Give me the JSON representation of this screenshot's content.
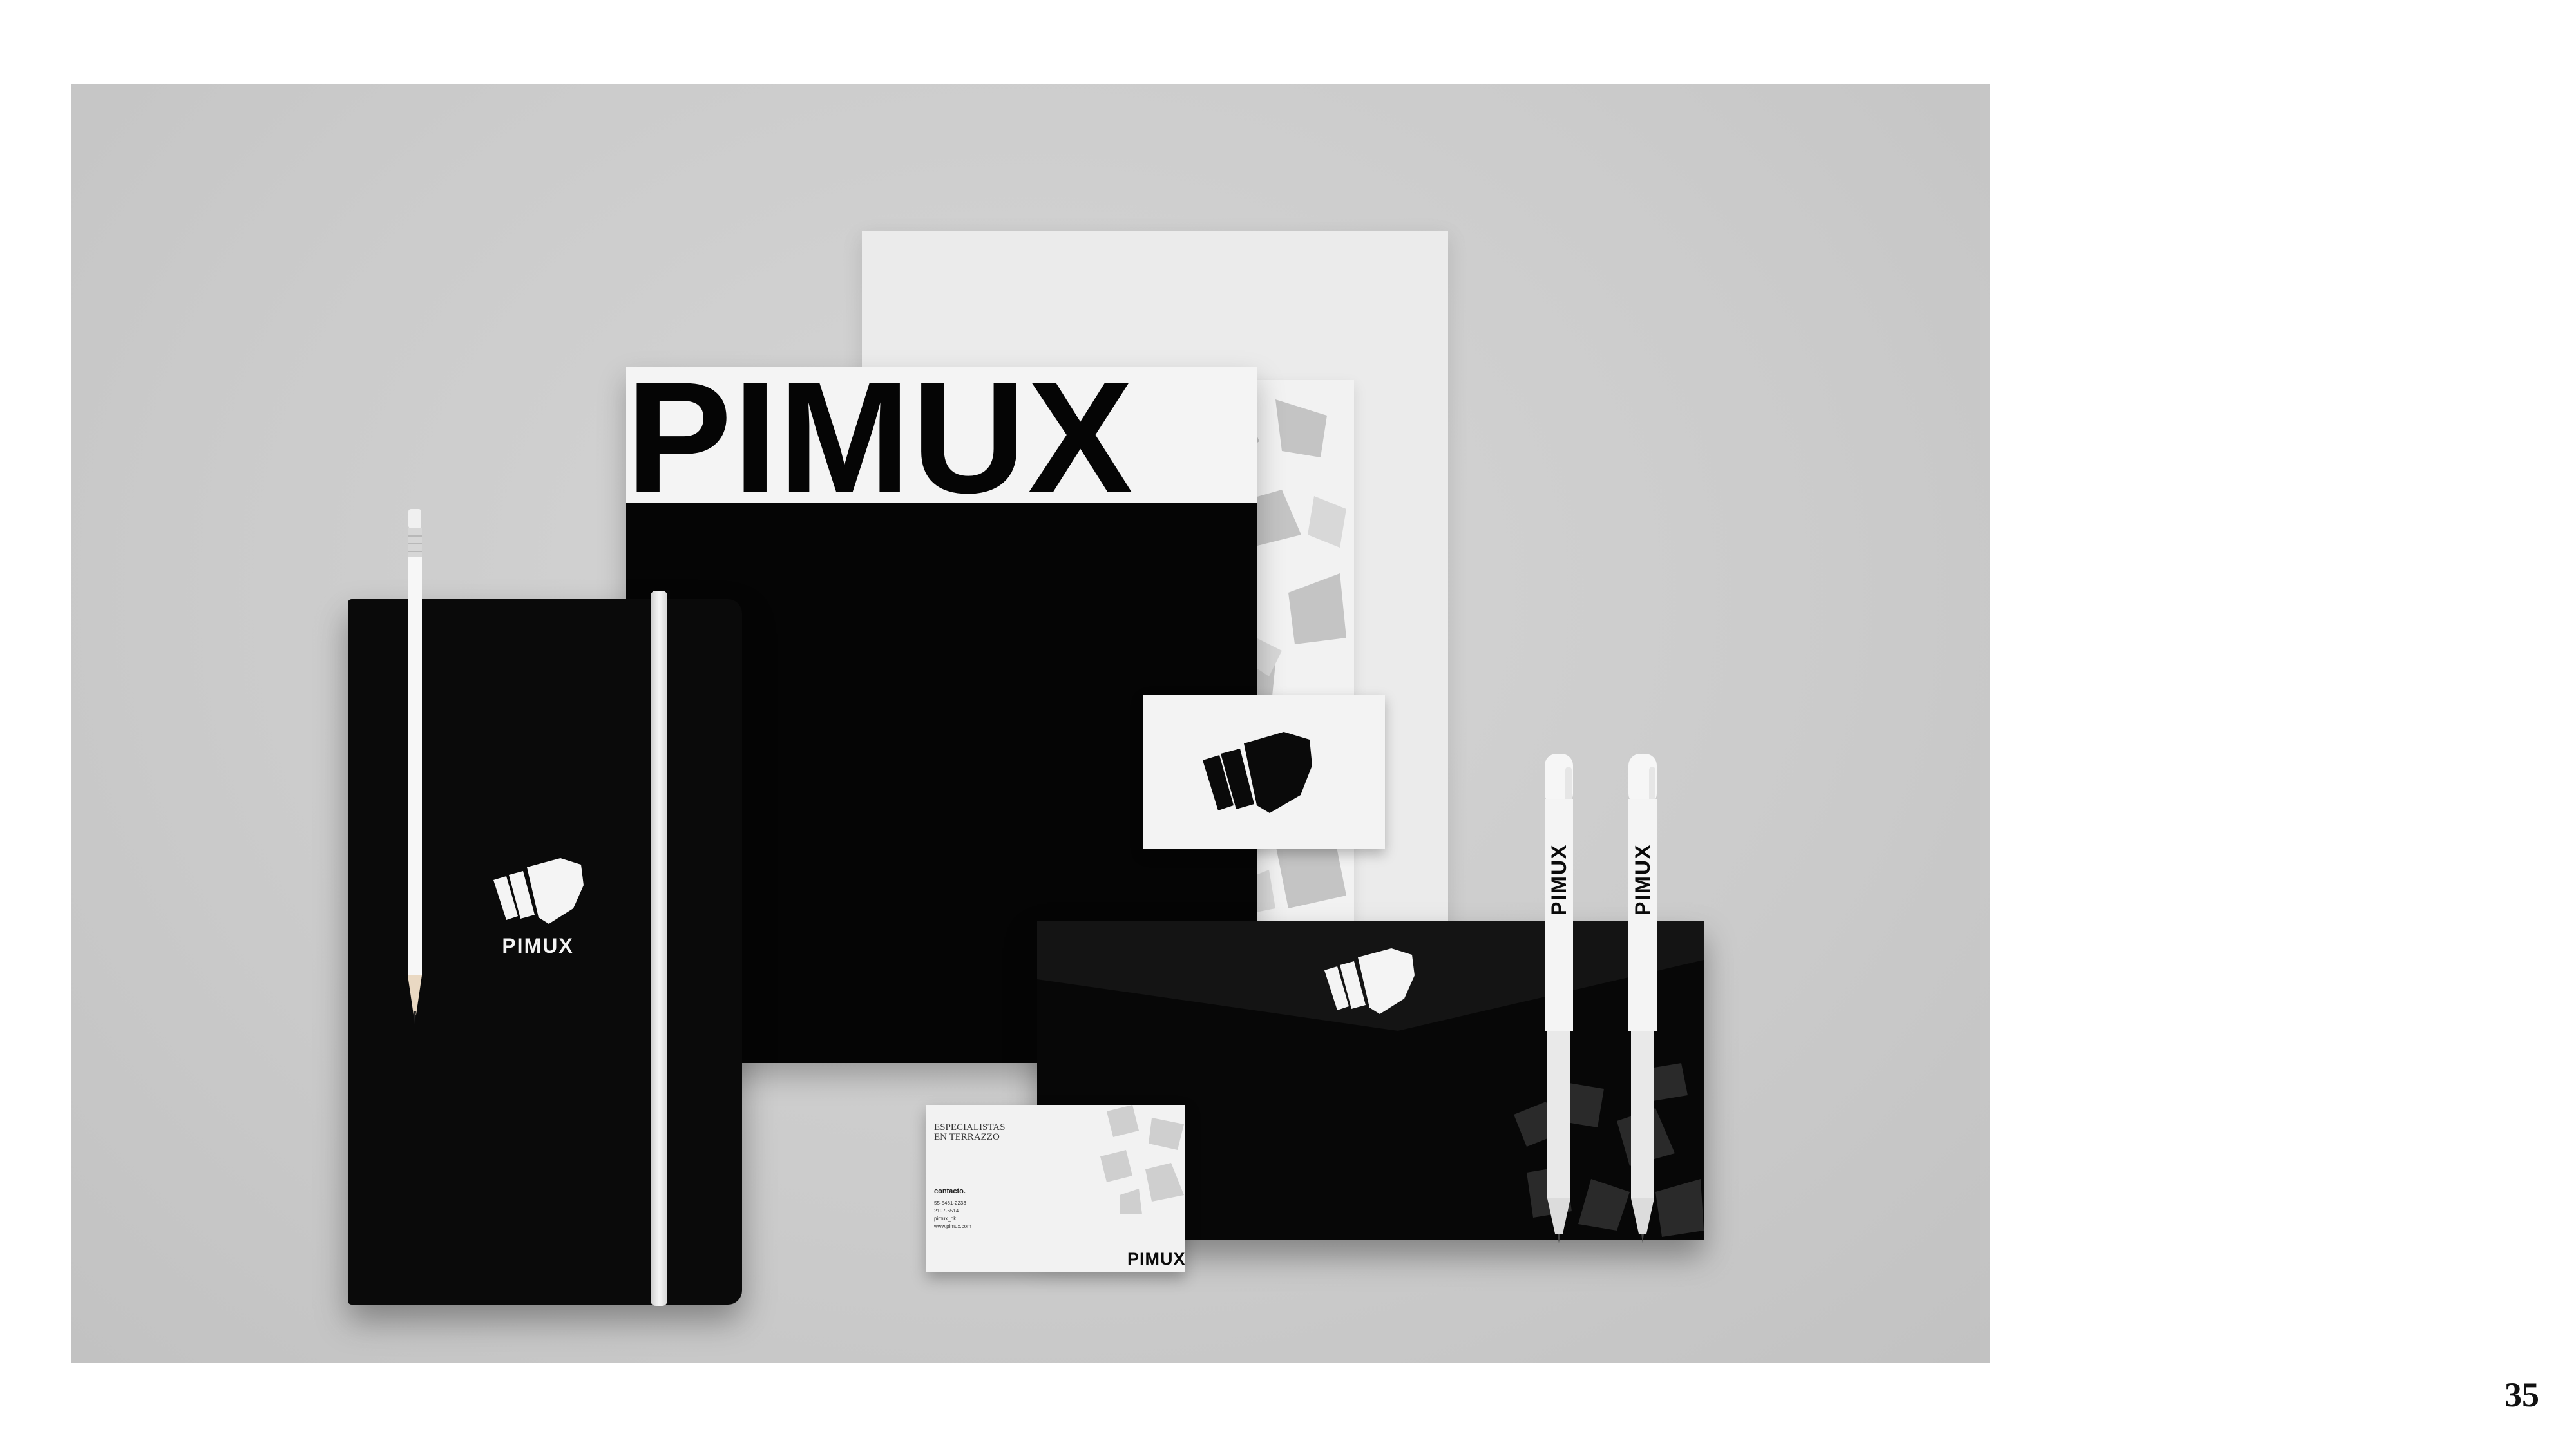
{
  "folder": {
    "wordmark": "PIMUX"
  },
  "notebook": {
    "wordmark": "PIMUX"
  },
  "pens": [
    {
      "label": "PIMUX"
    },
    {
      "label": "PIMUX"
    }
  ],
  "business_card": {
    "tagline_line1": "ESPECIALISTAS",
    "tagline_line2": "EN TERRAZZO",
    "contact_title": "contacto.",
    "contact_lines": [
      "55-5461-2233",
      "2197-6514",
      "pimux_ok",
      "www.pimux.com"
    ],
    "wordmark": "PIMUX"
  },
  "page_number": "35",
  "colors": {
    "brand_black": "#050505",
    "brand_white": "#f4f4f4",
    "backdrop": "#cbcbcb"
  }
}
